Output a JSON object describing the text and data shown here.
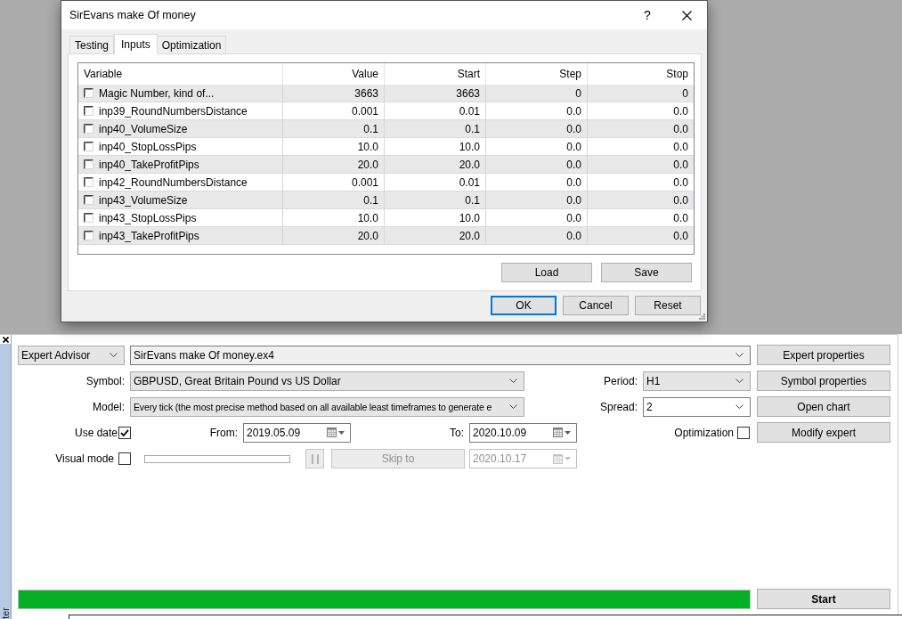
{
  "dialog": {
    "title": "SirEvans make Of money",
    "help": "?",
    "tabs": [
      {
        "label": "Testing",
        "selected": false
      },
      {
        "label": "Inputs",
        "selected": true
      },
      {
        "label": "Optimization",
        "selected": false
      }
    ],
    "inputs_table": {
      "columns": [
        "Variable",
        "Value",
        "Start",
        "Step",
        "Stop"
      ],
      "rows": [
        {
          "checked": false,
          "variable": "Magic Number, kind of...",
          "value": "3663",
          "start": "3663",
          "step": "0",
          "stop": "0"
        },
        {
          "checked": false,
          "variable": "inp39_RoundNumbersDistance",
          "value": "0.001",
          "start": "0.01",
          "step": "0.0",
          "stop": "0.0"
        },
        {
          "checked": false,
          "variable": "inp40_VolumeSize",
          "value": "0.1",
          "start": "0.1",
          "step": "0.0",
          "stop": "0.0"
        },
        {
          "checked": false,
          "variable": "inp40_StopLossPips",
          "value": "10.0",
          "start": "10.0",
          "step": "0.0",
          "stop": "0.0"
        },
        {
          "checked": false,
          "variable": "inp40_TakeProfitPips",
          "value": "20.0",
          "start": "20.0",
          "step": "0.0",
          "stop": "0.0"
        },
        {
          "checked": false,
          "variable": "inp42_RoundNumbersDistance",
          "value": "0.001",
          "start": "0.01",
          "step": "0.0",
          "stop": "0.0"
        },
        {
          "checked": false,
          "variable": "inp43_VolumeSize",
          "value": "0.1",
          "start": "0.1",
          "step": "0.0",
          "stop": "0.0"
        },
        {
          "checked": false,
          "variable": "inp43_StopLossPips",
          "value": "10.0",
          "start": "10.0",
          "step": "0.0",
          "stop": "0.0"
        },
        {
          "checked": false,
          "variable": "inp43_TakeProfitPips",
          "value": "20.0",
          "start": "20.0",
          "step": "0.0",
          "stop": "0.0"
        }
      ]
    },
    "table_buttons": [
      "Load",
      "Save"
    ],
    "buttons": [
      {
        "label": "OK",
        "default": true
      },
      {
        "label": "Cancel",
        "default": false
      },
      {
        "label": "Reset",
        "default": false
      }
    ]
  },
  "tester": {
    "side_tab": "ter",
    "expert_type": "Expert Advisor",
    "expert_file": "SirEvans make Of money.ex4",
    "symbol": {
      "label": "Symbol:",
      "value": "GBPUSD, Great Britain Pound vs US Dollar"
    },
    "period": {
      "label": "Period:",
      "value": "H1"
    },
    "model": {
      "label": "Model:",
      "value": "Every tick (the most precise method based on all available least timeframes to generate e"
    },
    "spread": {
      "label": "Spread:",
      "value": "2"
    },
    "use_date": {
      "label": "Use date",
      "checked": true
    },
    "from": {
      "label": "From:",
      "value": "2019.05.09",
      "disabled": false
    },
    "to": {
      "label": "To:",
      "value": "2020.10.09",
      "disabled": false
    },
    "optimization": {
      "label": "Optimization",
      "checked": false
    },
    "visual_mode": {
      "label": "Visual mode",
      "checked": false
    },
    "pause": {
      "disabled": true
    },
    "skip_to": {
      "label": "Skip to",
      "disabled": true
    },
    "skip_date": {
      "value": "2020.10.17",
      "disabled": true
    },
    "side_buttons": [
      "Expert properties",
      "Symbol properties",
      "Open chart",
      "Modify expert"
    ],
    "progress": {
      "level": 1
    },
    "start": "Start"
  }
}
